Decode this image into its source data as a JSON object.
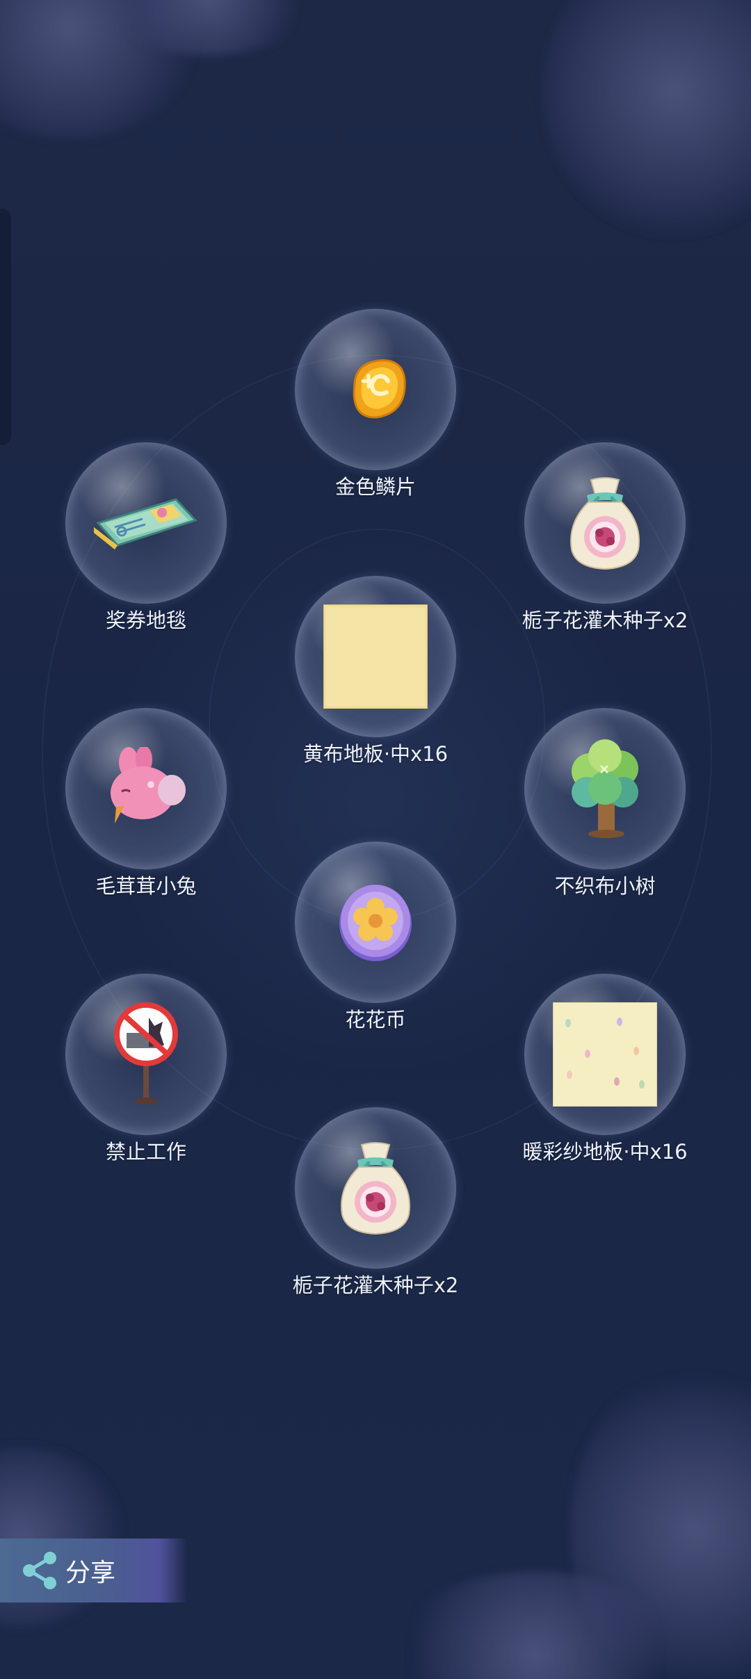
{
  "rewards": [
    {
      "name": "金色鳞片",
      "icon": "gold-scale-icon"
    },
    {
      "name": "奖券地毯",
      "icon": "ticket-rug-icon"
    },
    {
      "name": "栀子花灌木种子x2",
      "icon": "seed-bag-icon"
    },
    {
      "name": "黄布地板·中x16",
      "icon": "yellow-floor-tile-icon"
    },
    {
      "name": "毛茸茸小兔",
      "icon": "fluffy-bunny-icon"
    },
    {
      "name": "不织布小树",
      "icon": "felt-tree-icon"
    },
    {
      "name": "花花币",
      "icon": "flower-coin-icon"
    },
    {
      "name": "禁止工作",
      "icon": "no-work-sign-icon"
    },
    {
      "name": "暖彩纱地板·中x16",
      "icon": "pastel-floor-tile-icon"
    },
    {
      "name": "栀子花灌木种子x2",
      "icon": "seed-bag-icon"
    }
  ],
  "share": {
    "label": "分享",
    "icon": "share-icon"
  },
  "colors": {
    "background": "#1b2746",
    "label": "#eef3ff",
    "share_button": "#4c6a92"
  }
}
